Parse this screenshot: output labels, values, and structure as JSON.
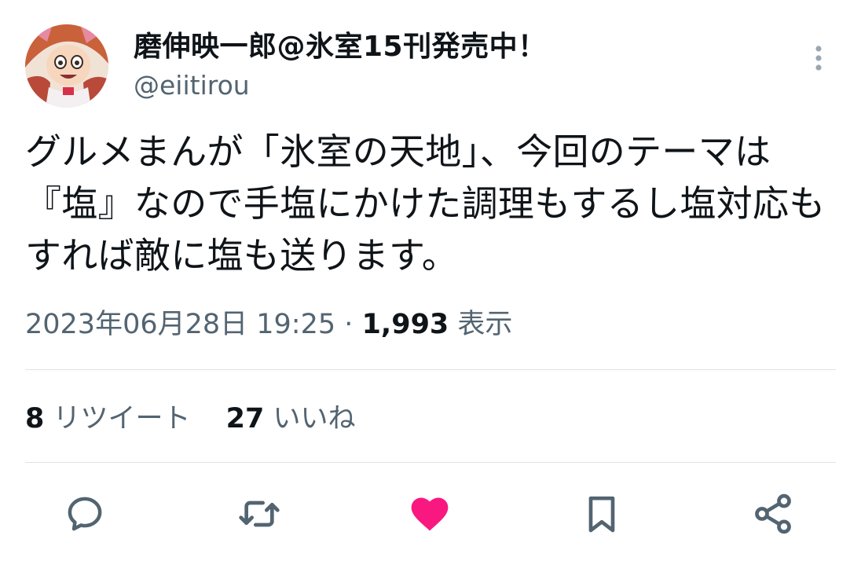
{
  "user": {
    "display_name": "磨伸映一郎@氷室15刊発売中！",
    "handle": "@eiitirou"
  },
  "tweet": {
    "text": "グルメまんが「氷室の天地」、今回のテーマは『塩』なので手塩にかけた調理もするし塩対応もすれば敵に塩も送ります。",
    "date": "2023年06月28日 19:25",
    "separator": "·",
    "views_count": "1,993",
    "views_label": "表示"
  },
  "stats": {
    "retweets_count": "8",
    "retweets_label": "リツイート",
    "likes_count": "27",
    "likes_label": "いいね"
  },
  "icons": {
    "more": "more-vertical-icon",
    "reply": "reply-icon",
    "retweet": "retweet-icon",
    "like": "heart-filled-icon",
    "bookmark": "bookmark-icon",
    "share": "share-icon"
  },
  "colors": {
    "text": "#0f1419",
    "secondary": "#536471",
    "like_active": "#f91880",
    "divider": "#dfe3e6"
  }
}
